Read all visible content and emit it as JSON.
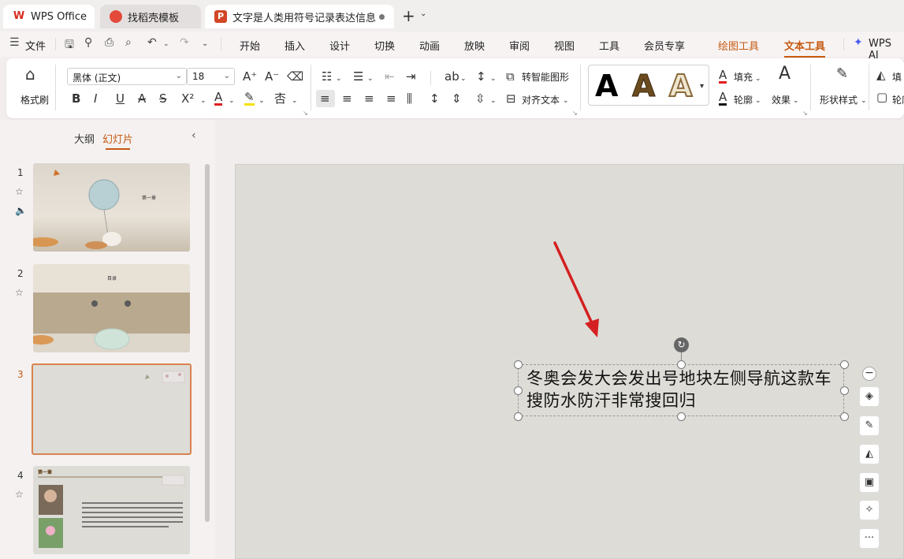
{
  "tabs": {
    "wps": {
      "label": "WPS Office",
      "icon": "wps-logo-icon"
    },
    "templates": {
      "label": "找稻壳模板",
      "icon": "daoke-icon"
    },
    "doc": {
      "label": "文字是人类用符号记录表达信息以",
      "icon": "presentation-file-icon",
      "modified": true
    }
  },
  "menu": {
    "file": "文件",
    "items": [
      "开始",
      "插入",
      "设计",
      "切换",
      "动画",
      "放映",
      "审阅",
      "视图",
      "工具",
      "会员专享"
    ],
    "drawing_tools": "绘图工具",
    "text_tools": "文本工具",
    "wps_ai": "WPS AI"
  },
  "ribbon": {
    "format_painter": "格式刷",
    "font_name": "黑体 (正文)",
    "font_size": "18",
    "smart_shape": "转智能图形",
    "align_text": "对齐文本",
    "text_styles": [
      "A",
      "A",
      "A"
    ],
    "fill": "填充",
    "outline": "轮廓",
    "effects": "效果",
    "shape_style": "形状样式",
    "fill_short": "填",
    "outline_short": "轮廓"
  },
  "left_panel": {
    "tab_outline": "大纲",
    "tab_slides": "幻灯片",
    "slides": [
      {
        "number": "1",
        "title": "第一章"
      },
      {
        "number": "2",
        "title": "目录"
      },
      {
        "number": "3",
        "title": ""
      },
      {
        "number": "4",
        "title": "第一章"
      }
    ]
  },
  "slide": {
    "textbox_text": "冬奥会发大会发出号地块左侧导航这款车搜防水防汗非常搜回归"
  },
  "colors": {
    "accent": "#c55a11",
    "arrow": "#d42020",
    "slide_bg": "#dddcd7"
  }
}
